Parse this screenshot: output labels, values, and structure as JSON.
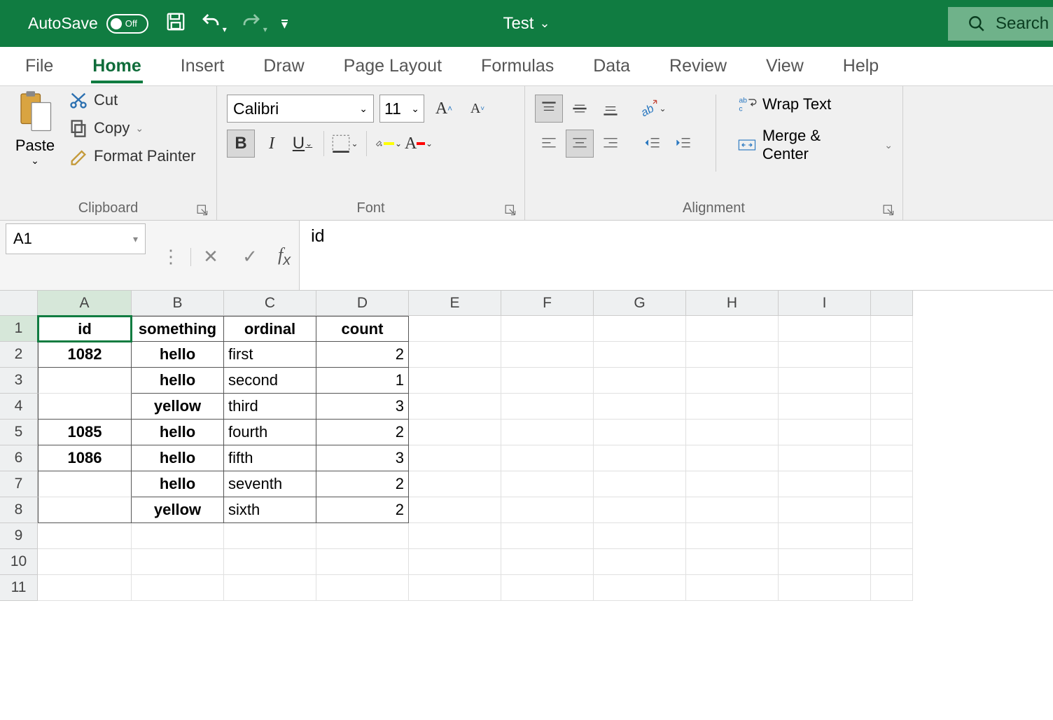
{
  "titlebar": {
    "autosave_label": "AutoSave",
    "autosave_state": "Off",
    "doc_name": "Test",
    "search_label": "Search"
  },
  "tabs": [
    "File",
    "Home",
    "Insert",
    "Draw",
    "Page Layout",
    "Formulas",
    "Data",
    "Review",
    "View",
    "Help"
  ],
  "ribbon": {
    "clipboard": {
      "paste": "Paste",
      "cut": "Cut",
      "copy": "Copy",
      "format_painter": "Format Painter",
      "group_label": "Clipboard"
    },
    "font": {
      "name": "Calibri",
      "size": "11",
      "group_label": "Font"
    },
    "alignment": {
      "wrap": "Wrap Text",
      "merge": "Merge & Center",
      "group_label": "Alignment"
    }
  },
  "formula": {
    "name_box": "A1",
    "value": "id"
  },
  "grid": {
    "columns": [
      "A",
      "B",
      "C",
      "D",
      "E",
      "F",
      "G",
      "H",
      "I"
    ],
    "rows": [
      "1",
      "2",
      "3",
      "4",
      "5",
      "6",
      "7",
      "8",
      "9",
      "10",
      "11"
    ],
    "data": [
      {
        "id": "id",
        "something": "something",
        "ordinal": "ordinal",
        "count": "count"
      },
      {
        "id": "1082",
        "something": "hello",
        "ordinal": "first",
        "count": "2"
      },
      {
        "id": "",
        "something": "hello",
        "ordinal": "second",
        "count": "1"
      },
      {
        "id": "",
        "something": "yellow",
        "ordinal": "third",
        "count": "3"
      },
      {
        "id": "1085",
        "something": "hello",
        "ordinal": "fourth",
        "count": "2"
      },
      {
        "id": "1086",
        "something": "hello",
        "ordinal": "fifth",
        "count": "3"
      },
      {
        "id": "",
        "something": "hello",
        "ordinal": "seventh",
        "count": "2"
      },
      {
        "id": "",
        "something": "yellow",
        "ordinal": "sixth",
        "count": "2"
      }
    ]
  }
}
